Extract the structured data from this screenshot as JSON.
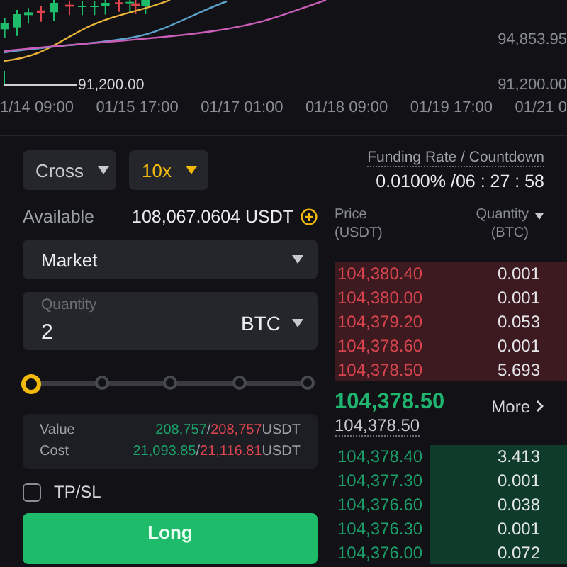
{
  "chart": {
    "price_labels": [
      "94,853.95",
      "91,200.00"
    ],
    "low_marker": "91,200.00",
    "time_labels": [
      "1/14 09:00",
      "01/15 17:00",
      "01/17 01:00",
      "01/18 09:00",
      "01/19 17:00",
      "01/21 0"
    ]
  },
  "order_form": {
    "margin_mode": "Cross",
    "leverage": "10x",
    "available_label": "Available",
    "available_value": "108,067.0604 USDT",
    "order_type": "Market",
    "quantity": {
      "placeholder": "Quantity",
      "value": "2",
      "unit": "BTC"
    },
    "slider": {
      "level": 0
    },
    "summary": [
      {
        "label": "Value",
        "buy": "208,757",
        "separator": "/",
        "sell": "208,757",
        "unit": "USDT"
      },
      {
        "label": "Cost",
        "buy": "21,093.85",
        "separator": "/",
        "sell": "21,116.81",
        "unit": "USDT"
      }
    ],
    "tpsl": {
      "label": "TP/SL",
      "checked": false
    },
    "long_button": "Long"
  },
  "order_book": {
    "funding_label": "Funding Rate / Countdown",
    "funding_value": "0.0100% /06 : 27 : 58",
    "price_header": [
      "Price",
      "(USDT)"
    ],
    "quantity_header": [
      "Quantity",
      "(BTC)"
    ],
    "asks": [
      {
        "price": "104,380.40",
        "quantity": "0.001"
      },
      {
        "price": "104,380.00",
        "quantity": "0.001"
      },
      {
        "price": "104,379.20",
        "quantity": "0.053"
      },
      {
        "price": "104,378.60",
        "quantity": "0.001"
      },
      {
        "price": "104,378.50",
        "quantity": "5.693"
      }
    ],
    "last_price": "104,378.50",
    "mark_price": "104,378.50",
    "more": "More",
    "bids": [
      {
        "price": "104,378.40",
        "quantity": "3.413"
      },
      {
        "price": "104,377.30",
        "quantity": "0.001"
      },
      {
        "price": "104,376.60",
        "quantity": "0.038"
      },
      {
        "price": "104,376.30",
        "quantity": "0.001"
      },
      {
        "price": "104,376.00",
        "quantity": "0.072"
      }
    ]
  }
}
